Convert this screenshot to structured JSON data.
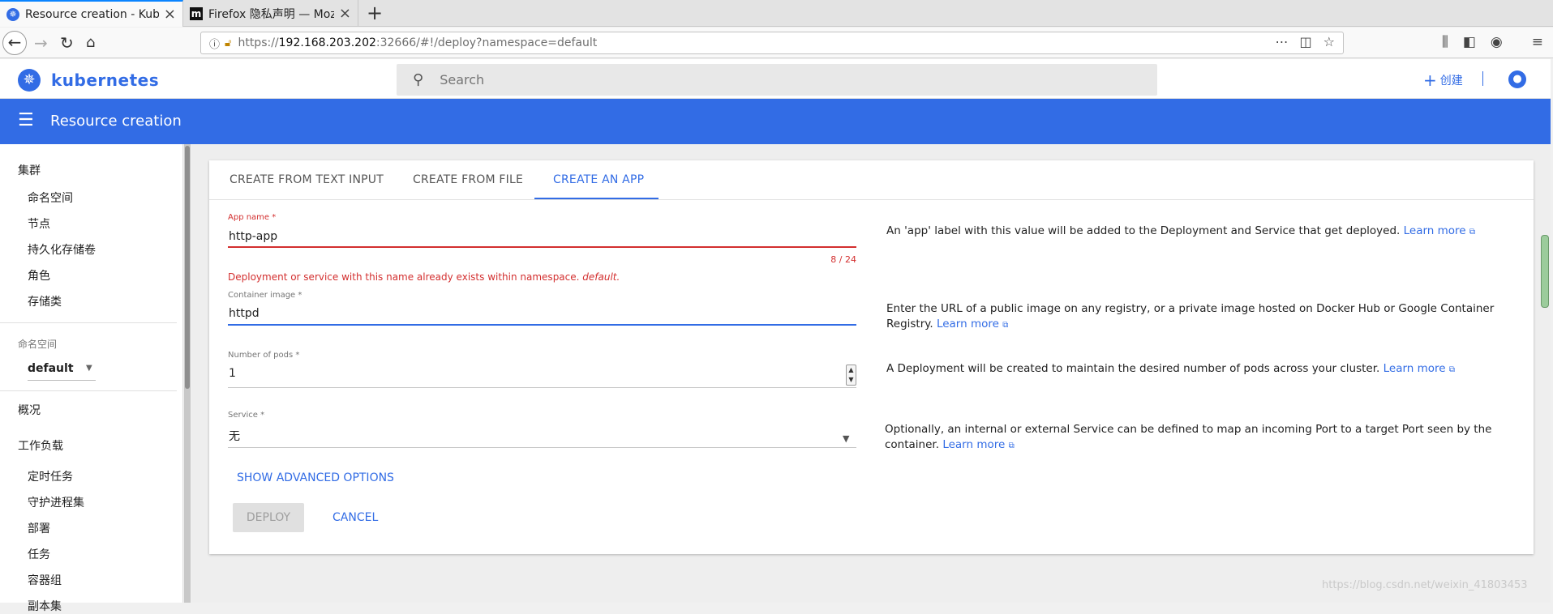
{
  "browser": {
    "tabs": [
      {
        "title": "Resource creation - Kube",
        "active": true
      },
      {
        "title": "Firefox 隐私声明 — Mozi",
        "active": false
      }
    ],
    "url": {
      "prefix": "https://",
      "host": "192.168.203.202",
      "rest": ":32666/#!/deploy?namespace=default"
    }
  },
  "header": {
    "brand": "kubernetes",
    "search_placeholder": "Search",
    "create_label": "创建"
  },
  "titlebar": {
    "title": "Resource creation"
  },
  "sidebar": {
    "cluster_group": "集群",
    "cluster_items": [
      "命名空间",
      "节点",
      "持久化存储卷",
      "角色",
      "存储类"
    ],
    "namespace_label": "命名空间",
    "namespace_value": "default",
    "overview": "概况",
    "workloads_group": "工作负载",
    "workload_items": [
      "定时任务",
      "守护进程集",
      "部署",
      "任务",
      "容器组",
      "副本集"
    ]
  },
  "form": {
    "tabs": [
      "CREATE FROM TEXT INPUT",
      "CREATE FROM FILE",
      "CREATE AN APP"
    ],
    "app_name": {
      "label": "App name *",
      "value": "http-app",
      "counter": "8 / 24",
      "error_text": "Deployment or service with this name already exists within namespace. ",
      "error_ns": "default."
    },
    "container_image": {
      "label": "Container image *",
      "value": "httpd"
    },
    "pods": {
      "label": "Number of pods *",
      "value": "1"
    },
    "service": {
      "label": "Service *",
      "value": "无"
    },
    "help": {
      "app_name": "An 'app' label with this value will be added to the Deployment and Service that get deployed. ",
      "container_image": "Enter the URL of a public image on any registry, or a private image hosted on Docker Hub or Google Container Registry. ",
      "pods": "A Deployment will be created to maintain the desired number of pods across your cluster. ",
      "service": "Optionally, an internal or external Service can be defined to map an incoming Port to a target Port seen by the container. ",
      "learn_more": "Learn more"
    },
    "advanced_label": "SHOW ADVANCED OPTIONS",
    "deploy_label": "DEPLOY",
    "cancel_label": "CANCEL"
  },
  "watermark": "https://blog.csdn.net/weixin_41803453",
  "colors": {
    "accent": "#326ce5",
    "error": "#d32f2f"
  }
}
